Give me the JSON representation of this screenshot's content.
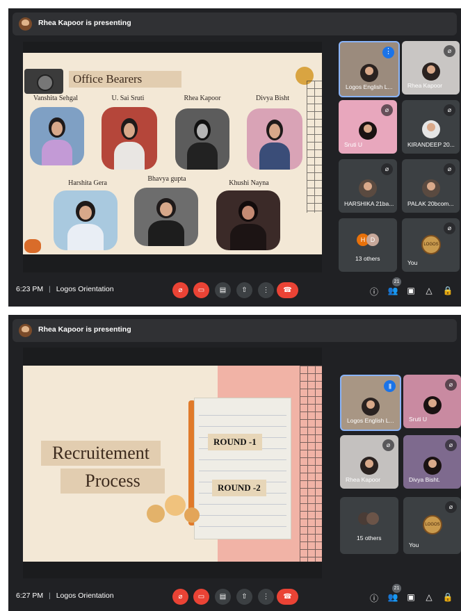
{
  "screenshots": [
    {
      "presenter_text": "Rhea Kapoor is presenting",
      "slide": {
        "title": "Office Bearers",
        "people": [
          {
            "name": "Vanshita Sehgal"
          },
          {
            "name": "U. Sai Sruti"
          },
          {
            "name": "Rhea Kapoor"
          },
          {
            "name": "Divya Bisht"
          },
          {
            "name": "Harshita Gera"
          },
          {
            "name": "Bhavya gupta"
          },
          {
            "name": "Khushi Nayna"
          }
        ]
      },
      "tiles": [
        {
          "name": "Logos English L...",
          "type": "video"
        },
        {
          "name": "Rhea Kapoor",
          "type": "video"
        },
        {
          "name": "Sruti U",
          "type": "video"
        },
        {
          "name": "KIRANDEEP 20...",
          "type": "avatar"
        },
        {
          "name": "HARSHIKA 21ba...",
          "type": "avatar"
        },
        {
          "name": "PALAK 20bcom...",
          "type": "avatar"
        },
        {
          "name": "13 others",
          "type": "others",
          "initials": [
            "H",
            "D"
          ]
        },
        {
          "name": "You",
          "type": "self"
        }
      ],
      "time": "6:23 PM",
      "separator": "|",
      "meeting_name": "Logos Orientation",
      "participants_count": "21"
    },
    {
      "presenter_text": "Rhea Kapoor is presenting",
      "slide": {
        "title_line1": "Recruitement",
        "title_line2": "Process",
        "round1": "ROUND -1",
        "round2": "ROUND -2"
      },
      "tiles": [
        {
          "name": "Logos English L...",
          "type": "video"
        },
        {
          "name": "Sruti U",
          "type": "video"
        },
        {
          "name": "Rhea Kapoor",
          "type": "video"
        },
        {
          "name": "Divya Bisht.",
          "type": "video"
        },
        {
          "name": "15 others",
          "type": "others"
        },
        {
          "name": "You",
          "type": "self"
        }
      ],
      "time": "6:27 PM",
      "separator": "|",
      "meeting_name": "Logos Orientation",
      "participants_count": "21"
    }
  ],
  "icons": {
    "more": "⋮",
    "info": "ⓘ",
    "mic_off": "🎙",
    "end_call": "☎"
  },
  "colors": {
    "meet_bg": "#202124",
    "tile_bg": "#3c4043",
    "red_button": "#ea4335",
    "active_blue": "#1a73e8"
  }
}
